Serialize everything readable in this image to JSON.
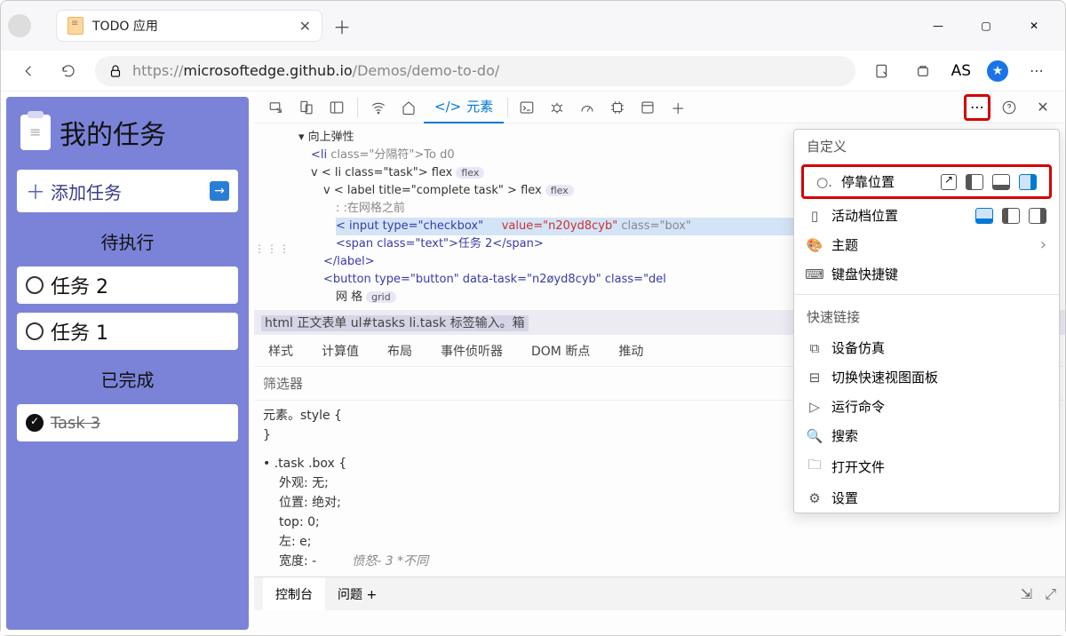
{
  "tab": {
    "title": "TODO 应用"
  },
  "url": {
    "protocol": "https://",
    "host": "microsoftedge.github.io",
    "path": "/Demos/demo-to-do/"
  },
  "profile": "AS",
  "app": {
    "title": "我的任务",
    "add": "添加任务",
    "pending_label": "待执行",
    "done_label": "已完成",
    "tasks_pending": [
      "任务 2",
      "任务 1"
    ],
    "tasks_done": [
      "Task 3"
    ]
  },
  "devtools": {
    "elements_tab": "元素",
    "dom": {
      "l1": "向上弹性",
      "l2_open": "<",
      "l2_tag": "li",
      "l2_attr": " class=\"分隔符\">To d0",
      "l3": "v < li class=\"task\"> flex",
      "l4": "v < label title=\"complete task\" > flex",
      "l5": ": :在网格之前",
      "l6a": "< input type=\"checkbox\"",
      "l6b_name": "value=",
      "l6b_val": "\"n20yd8cyb\"",
      "l6c": "  class=\"box\"",
      "l7": "<span class=\"text\">任务 2</span>",
      "l8": "</label>",
      "l9": "<button type=\"button\" data-task=\"n2øyd8cyb\" class=\"del",
      "l10": "网 格"
    },
    "breadcrumb": "html 正文表单 ul#tasks li.task 标签输入。箱",
    "styles_tabs": [
      "样式",
      "计算值",
      "布局",
      "事件侦听器",
      "DOM 断点",
      "推动"
    ],
    "filter": "筛选器",
    "rule1": "元素。style {",
    "rule1_close": "}",
    "rule2": ".task .box {",
    "props": [
      "外观: 无;",
      "位置: 绝对;",
      "top: 0;",
      "左: e;",
      "宽度: -"
    ],
    "diff_label": "愤怒-      3  *不同",
    "drawer": {
      "console": "控制台",
      "issues": "问题 +"
    }
  },
  "menu": {
    "custom": "自定义",
    "dock": "停靠位置",
    "activity": "活动档位置",
    "theme": "主题",
    "shortcuts": "键盘快捷键",
    "quick": "快速链接",
    "items": [
      "设备仿真",
      "切换快速视图面板",
      "运行命令",
      "搜索",
      "打开文件",
      "设置"
    ]
  }
}
